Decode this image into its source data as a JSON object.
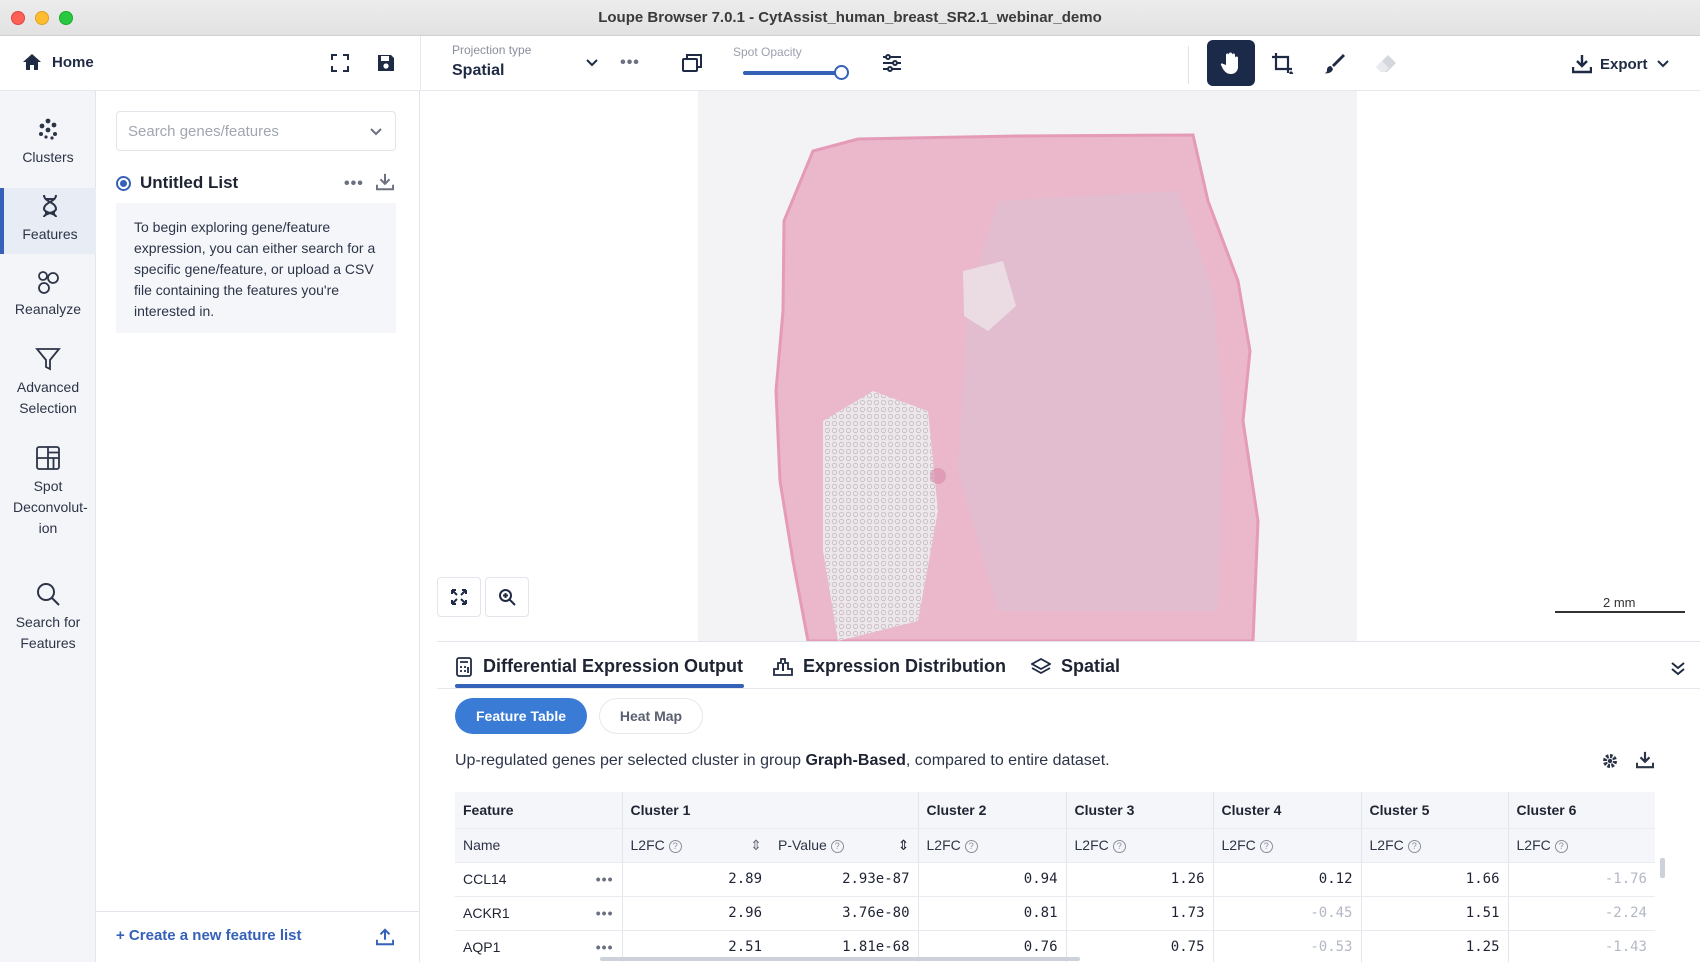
{
  "window": {
    "title": "Loupe Browser 7.0.1 - CytAssist_human_breast_SR2.1_webinar_demo"
  },
  "toolbar": {
    "home_label": "Home",
    "projection_label": "Projection type",
    "projection_value": "Spatial",
    "opacity_label": "Spot Opacity",
    "opacity_value": 1.0,
    "export_label": "Export"
  },
  "nav": {
    "items": [
      {
        "label": "Clusters",
        "icon": "clusters-icon"
      },
      {
        "label": "Features",
        "icon": "features-icon",
        "active": true
      },
      {
        "label": "Reanalyze",
        "icon": "reanalyze-icon"
      },
      {
        "label": "Advanced Selection",
        "icon": "filter-icon"
      },
      {
        "label": "Spot Deconvolut-ion",
        "icon": "grid-icon"
      },
      {
        "label": "Search for Features",
        "icon": "search-icon"
      }
    ]
  },
  "feature_panel": {
    "search_placeholder": "Search genes/features",
    "list_title": "Untitled List",
    "hint": "To begin exploring gene/feature expression, you can either search for a specific gene/feature, or upload a CSV file containing the features you're interested in.",
    "create_link": "+ Create a new feature list"
  },
  "viewer": {
    "scale_label": "2 mm"
  },
  "bottom": {
    "tabs": [
      "Differential Expression Output",
      "Expression Distribution",
      "Spatial"
    ],
    "subtabs": [
      "Feature Table",
      "Heat Map"
    ],
    "desc_prefix": "Up-regulated genes per selected cluster in group ",
    "desc_group": "Graph-Based",
    "desc_suffix": ", compared to entire dataset.",
    "table": {
      "group_headers": [
        "Feature",
        "Cluster 1",
        "Cluster 2",
        "Cluster 3",
        "Cluster 4",
        "Cluster 5",
        "Cluster 6"
      ],
      "sub_headers": [
        "Name",
        "L2FC",
        "P-Value",
        "L2FC",
        "L2FC",
        "L2FC",
        "L2FC",
        "L2FC"
      ],
      "rows": [
        {
          "name": "CCL14",
          "c1_l2fc": "2.89",
          "c1_p": "2.93e-87",
          "c2": "0.94",
          "c3": "1.26",
          "c4": "0.12",
          "c5": "1.66",
          "c6": "-1.76"
        },
        {
          "name": "ACKR1",
          "c1_l2fc": "2.96",
          "c1_p": "3.76e-80",
          "c2": "0.81",
          "c3": "1.73",
          "c4": "-0.45",
          "c5": "1.51",
          "c6": "-2.24"
        },
        {
          "name": "AQP1",
          "c1_l2fc": "2.51",
          "c1_p": "1.81e-68",
          "c2": "0.76",
          "c3": "0.75",
          "c4": "-0.53",
          "c5": "1.25",
          "c6": "-1.43"
        }
      ]
    }
  },
  "colors": {
    "accent": "#3561b8",
    "active_tool": "#1c2a4a",
    "tissue": "#e9a9c2"
  }
}
